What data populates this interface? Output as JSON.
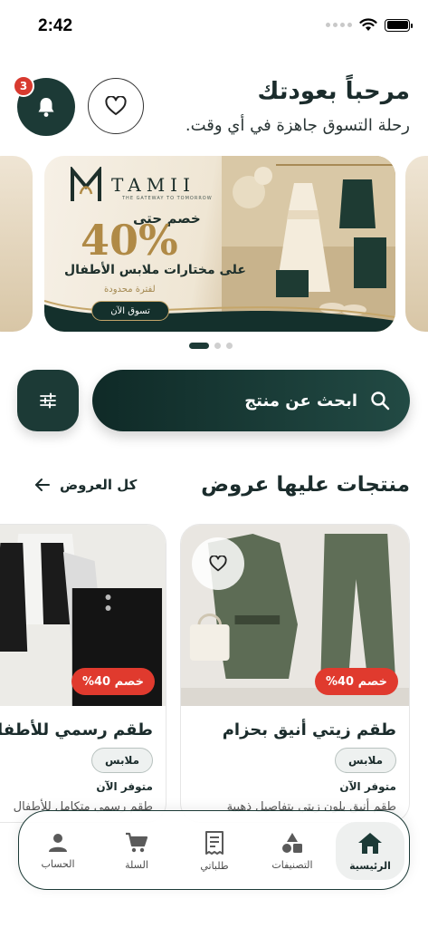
{
  "status": {
    "time": "2:42"
  },
  "header": {
    "title": "مرحباً بعودتك",
    "subtitle": "رحلة التسوق جاهزة في أي وقت.",
    "notification_count": "3"
  },
  "banner": {
    "brand": "TAMII",
    "tagline": "THE GATEWAY TO TOMORROW",
    "pre": "خصم حتى",
    "percent": "40%",
    "line": "على مختارات ملابس الأطفال",
    "note": "لفترة محدودة",
    "cta": "تسوق الآن"
  },
  "pager": {
    "count": 3,
    "active": 0
  },
  "search": {
    "placeholder": "ابحث عن منتج"
  },
  "offers": {
    "title": "منتجات عليها عروض",
    "see_all": "كل العروض",
    "products": [
      {
        "name": "طقم زيتي أنيق بحزام",
        "discount": "خصم 40%",
        "category": "ملابس",
        "stock": "متوفر الآن",
        "desc": "طقم أنيق بلون زيتي بتفاصيل ذهبية"
      },
      {
        "name": "طقم رسمي للأطفال",
        "discount": "خصم 40%",
        "category": "ملابس",
        "stock": "متوفر الآن",
        "desc": "طقم رسمي متكامل للأطفال"
      }
    ]
  },
  "tabbar": {
    "home": "الرئيسية",
    "categories": "التصنيفات",
    "orders": "طلباتي",
    "cart": "السلة",
    "account": "الحساب"
  },
  "colors": {
    "primary": "#1c3a36",
    "badge": "#d83a2f",
    "discount": "#e03a2e",
    "gold": "#b08a46"
  }
}
